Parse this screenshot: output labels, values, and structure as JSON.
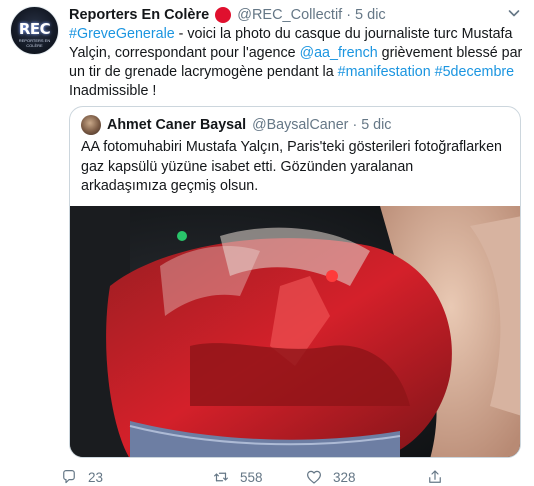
{
  "tweet": {
    "display_name": "Reporters En Colère",
    "handle": "@REC_Collectif",
    "separator": "·",
    "time": "5 dic",
    "avatar_text": "REC",
    "avatar_subtext": "REPORTERS EN COLÈRE",
    "badge_color": "#e0102e",
    "text": {
      "l1_hashtag": "#GreveGenerale",
      "l1_rest": " - voici la photo du casque du journaliste turc Mustafa",
      "l2_start": "Yalçin, correspondant pour l'agence ",
      "l2_mention": "@aa_french",
      "l2_rest": " grièvement blessé par",
      "l3_start": "un tir de grenade lacrymogène pendant la ",
      "l3_tag1": "#manifestation",
      "l3_space": " ",
      "l3_tag2": "#5decembre",
      "l4": "Inadmissible !"
    }
  },
  "quoted": {
    "display_name": "Ahmet Caner Baysal",
    "handle": "@BaysalCaner",
    "separator": "·",
    "time": "5 dic",
    "lines": [
      "AA fotomuhabiri Mustafa Yalçın, Paris'teki gösterileri fotoğraflarken",
      "gaz kapsülü yüzüne isabet etti. Gözünden yaralanan",
      "arkadaşımıza geçmiş olsun."
    ]
  },
  "actions": {
    "reply": {
      "icon": "reply-icon",
      "count": "23"
    },
    "retweet": {
      "icon": "retweet-icon",
      "count": "558"
    },
    "like": {
      "icon": "like-icon",
      "count": "328"
    },
    "share": {
      "icon": "share-icon"
    }
  },
  "colors": {
    "link": "#1b95e0",
    "secondary_text": "#657786",
    "border": "#ccd6dd"
  }
}
